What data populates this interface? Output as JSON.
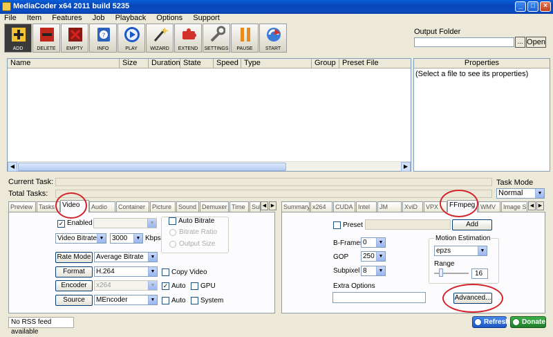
{
  "window": {
    "title": "MediaCoder x64 2011 build 5235",
    "min": "_",
    "max": "□",
    "close": "×"
  },
  "menu": [
    "File",
    "Item",
    "Features",
    "Job",
    "Playback",
    "Options",
    "Support"
  ],
  "toolbar": [
    "ADD",
    "DELETE",
    "EMPTY",
    "INFO",
    "PLAY",
    "WIZARD",
    "EXTEND",
    "SETTINGS",
    "PAUSE",
    "START"
  ],
  "output": {
    "label": "Output Folder",
    "browse": "...",
    "open": "Open"
  },
  "filelist": {
    "columns": [
      "Name",
      "Size",
      "Duration",
      "State",
      "Speed",
      "Type",
      "Group",
      "Preset File"
    ]
  },
  "properties": {
    "header": "Properties",
    "hint": "(Select a file to see its properties)"
  },
  "tasks": {
    "current": "Current Task:",
    "total": "Total Tasks:",
    "mode_label": "Task Mode",
    "mode_value": "Normal"
  },
  "left_tabs": [
    "Preview",
    "Tasks",
    "Video",
    "Audio",
    "Container",
    "Picture",
    "Sound",
    "Demuxer",
    "Time",
    "Sub"
  ],
  "right_tabs": [
    "Summary",
    "x264",
    "CUDA",
    "Intel",
    "JM",
    "XviD",
    "VPX",
    "FFmpeg",
    "WMV",
    "Image Se"
  ],
  "video": {
    "enabled": "Enabled",
    "auto_bitrate": "Auto Bitrate",
    "bitrate_ratio": "Bitrate Ratio",
    "output_size": "Output Size",
    "mode": "Video Bitrate",
    "bitrate": "3000",
    "kbps": "Kbps",
    "rate_mode_btn": "Rate Mode",
    "rate_mode_val": "Average Bitrate",
    "format_btn": "Format",
    "format_val": "H.264",
    "copy_video": "Copy Video",
    "encoder_btn": "Encoder",
    "encoder_val": "x264",
    "auto": "Auto",
    "gpu": "GPU",
    "source_btn": "Source",
    "source_val": "MEncoder",
    "system": "System"
  },
  "ffmpeg": {
    "preset": "Preset",
    "add": "Add",
    "bframes_label": "B-Frames",
    "bframes": "0",
    "gop_label": "GOP",
    "gop": "250",
    "subpixel_label": "Subpixel",
    "subpixel": "8",
    "motion_label": "Motion Estimation",
    "motion": "epzs",
    "range_label": "Range",
    "range": "16",
    "extra_label": "Extra Options",
    "advanced": "Advanced..."
  },
  "status": {
    "rss": "No RSS feed available",
    "refresh": "Refresh",
    "donate": "Donate"
  },
  "colors": {
    "title": "#0a4cc2",
    "accent": "#d2232a"
  }
}
